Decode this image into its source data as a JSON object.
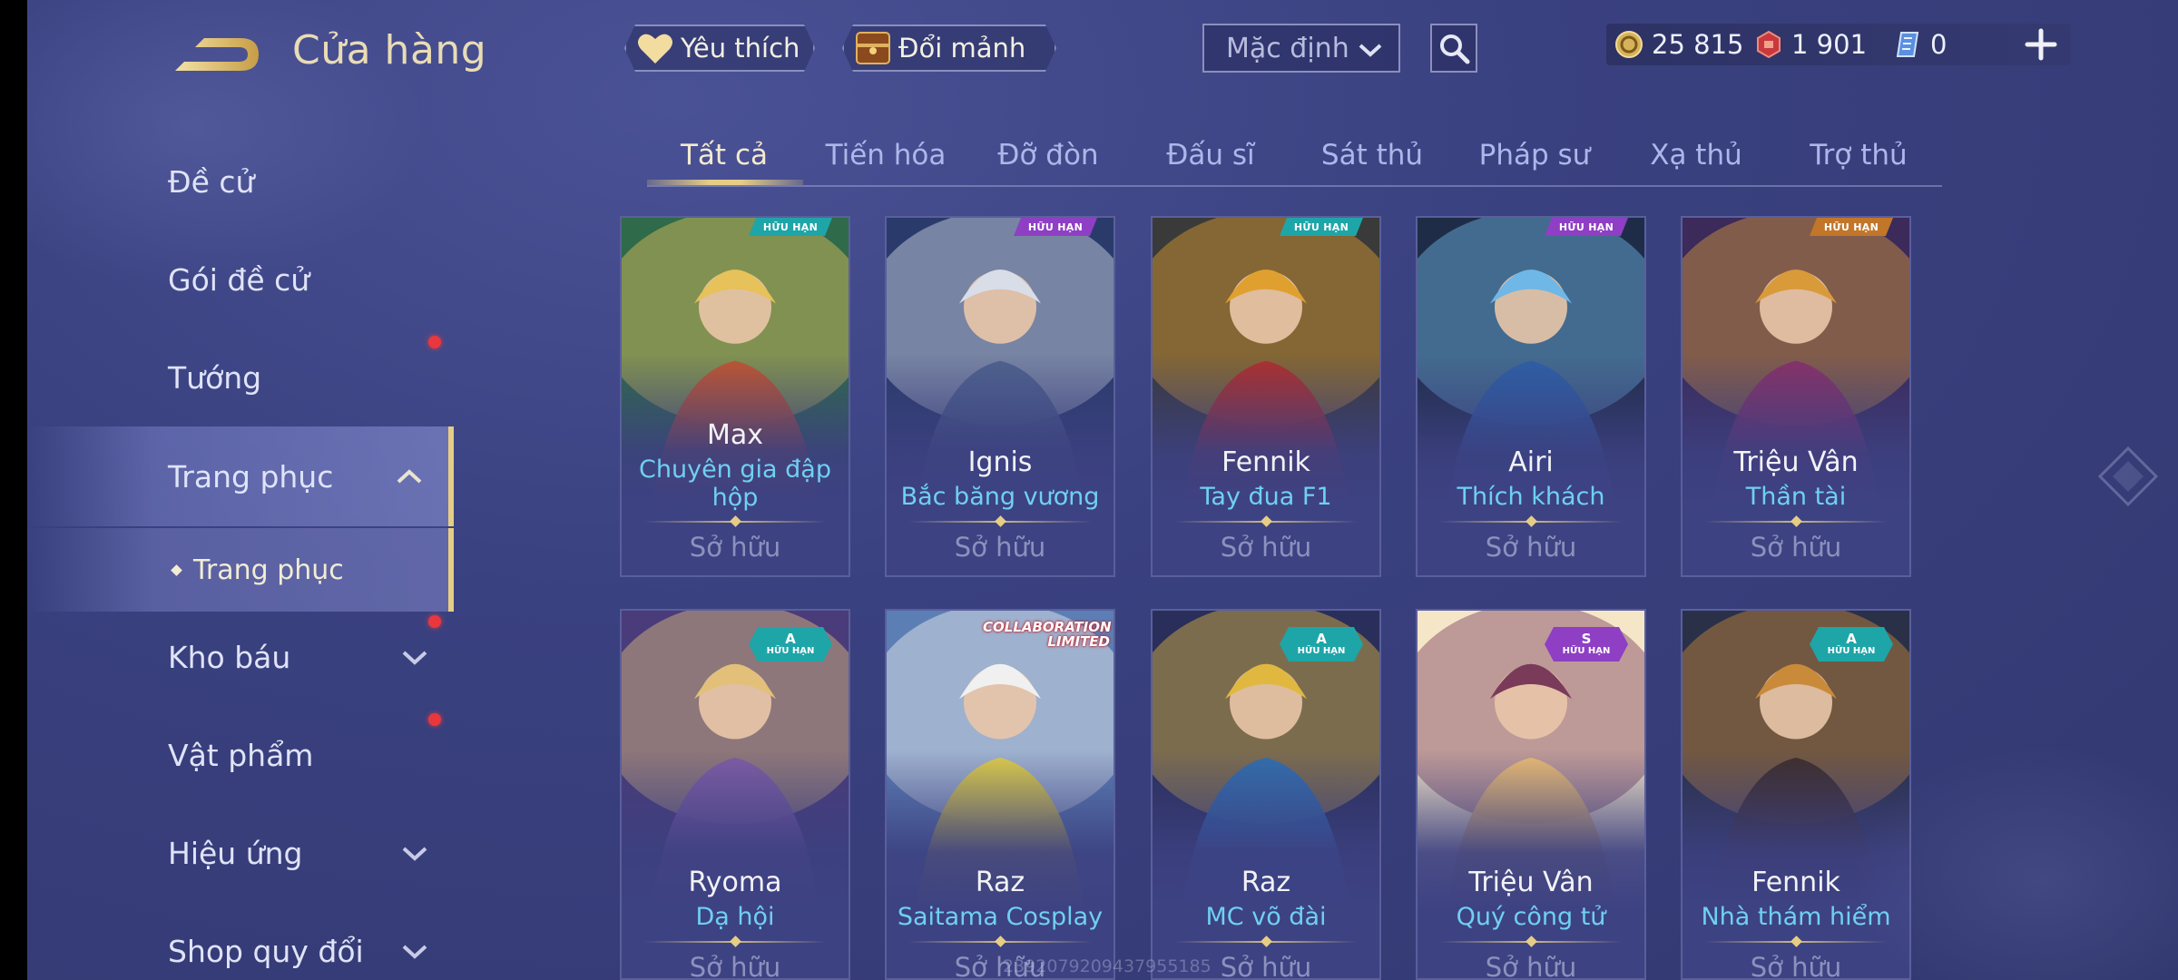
{
  "header": {
    "title": "Cửa hàng",
    "back_icon": "back-arrow-icon"
  },
  "sidebar": {
    "items": [
      {
        "label": "Đề cử",
        "dot": false
      },
      {
        "label": "Gói đề cử",
        "dot": true
      },
      {
        "label": "Tướng",
        "dot": false
      },
      {
        "label": "Trang phục",
        "dot": false,
        "active": true,
        "expanded": true
      },
      {
        "label": "Kho báu",
        "dot": true,
        "chevron": "down"
      },
      {
        "label": "Vật phẩm",
        "dot": true
      },
      {
        "label": "Hiệu ứng",
        "dot": false,
        "chevron": "down"
      },
      {
        "label": "Shop quy đổi",
        "dot": false,
        "chevron": "down"
      }
    ],
    "sub_item": {
      "label": "Trang phục"
    }
  },
  "toolbar": {
    "favorite_label": "Yêu thích",
    "exchange_label": "Đổi mảnh",
    "sort_value": "Mặc định"
  },
  "currency": {
    "gold": "25 815",
    "vouchers": "1 901",
    "tokens": "0"
  },
  "tabs": [
    "Tất cả",
    "Tiến hóa",
    "Đỡ đòn",
    "Đấu sĩ",
    "Sát thủ",
    "Pháp sư",
    "Xạ thủ",
    "Trợ thủ"
  ],
  "cards": [
    {
      "hero": "Max",
      "skin": "Chuyên gia đập hộp",
      "owned": "Sở hữu",
      "badge": "HỮU HẠN",
      "badge_color": "#1ea5a8",
      "palette": [
        "#c9512b",
        "#e7c15a",
        "#2f6a4a"
      ]
    },
    {
      "hero": "Ignis",
      "skin": "Bắc băng vương",
      "owned": "Sở hữu",
      "badge": "HỮU HẠN",
      "badge_color": "#8e3fc4",
      "palette": [
        "#4a5f8c",
        "#d8dde8",
        "#2a3b6b"
      ]
    },
    {
      "hero": "Fennik",
      "skin": "Tay đua F1",
      "owned": "Sở hữu",
      "badge": "HỮU HẠN",
      "badge_color": "#1ea5a8",
      "palette": [
        "#b52a2a",
        "#e0a02f",
        "#3a3a3a"
      ]
    },
    {
      "hero": "Airi",
      "skin": "Thích khách",
      "owned": "Sở hữu",
      "badge": "HỮU HẠN",
      "badge_color": "#8e3fc4",
      "palette": [
        "#2c5fa8",
        "#6fb7e6",
        "#1f2c48"
      ]
    },
    {
      "hero": "Triệu Vân",
      "skin": "Thần tài",
      "owned": "Sở hữu",
      "badge": "HỮU HẠN",
      "badge_color": "#c2762a",
      "palette": [
        "#8a2d6a",
        "#d99a3a",
        "#3b2a5a"
      ]
    },
    {
      "hero": "Ryoma",
      "skin": "Dạ hội",
      "owned": "Sở hữu",
      "tier": "A",
      "badge": "HỮU HẠN",
      "badge_color": "#1ea5a8",
      "palette": [
        "#7d5aa8",
        "#e2c07a",
        "#4a3b7a"
      ]
    },
    {
      "hero": "Raz",
      "skin": "Saitama Cosplay",
      "owned": "Sở hữu",
      "collab": "COLLABORATION LIMITED",
      "palette": [
        "#e6d13a",
        "#f0f0f0",
        "#5b7fb5"
      ]
    },
    {
      "hero": "Raz",
      "skin": "MC võ đài",
      "owned": "Sở hữu",
      "tier": "A",
      "badge": "HỮU HẠN",
      "badge_color": "#1ea5a8",
      "palette": [
        "#2b6fb8",
        "#e0b840",
        "#2a2e5a"
      ]
    },
    {
      "hero": "Triệu Vân",
      "skin": "Quý công tử",
      "owned": "Sở hữu",
      "tier": "S",
      "badge": "HỮU HẠN",
      "badge_color": "#8e3fc4",
      "palette": [
        "#f0c070",
        "#7a3b5a",
        "#f5e6c8"
      ]
    },
    {
      "hero": "Fennik",
      "skin": "Nhà thám hiểm",
      "owned": "Sở hữu",
      "tier": "A",
      "badge": "HỮU HẠN",
      "badge_color": "#1ea5a8",
      "palette": [
        "#3a2a28",
        "#c98a3a",
        "#2a3048"
      ]
    }
  ],
  "watermark": "2392079209437955185",
  "colors": {
    "accent_gold": "#e6cd86",
    "skin_name": "#6fd0f2",
    "dot_red": "#e9373d"
  }
}
